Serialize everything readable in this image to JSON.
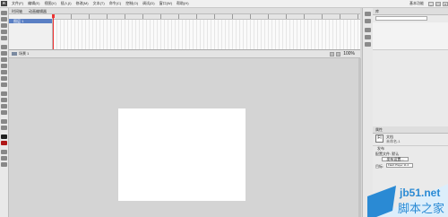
{
  "app": {
    "logo": "Fl"
  },
  "menu": [
    "文件(F)",
    "编辑(E)",
    "视图(V)",
    "插入(I)",
    "修改(M)",
    "文本(T)",
    "命令(C)",
    "控制(O)",
    "调试(D)",
    "窗口(W)",
    "帮助(H)"
  ],
  "workspace": {
    "label": "基本功能"
  },
  "timeline": {
    "tabs": [
      "时间轴",
      "动画编辑器"
    ],
    "layer_name": "图层 1"
  },
  "stage": {
    "scene": "场景 1",
    "zoom": "100%"
  },
  "library": {
    "tab": "库",
    "search_placeholder": ""
  },
  "properties": {
    "tab": "属性",
    "doc_icon": "Fl",
    "doc_label": "文档",
    "doc_name": "未命名-1",
    "publish_section": "发布",
    "config_label": "配置文件: 默认",
    "profile_button": "发布设置...",
    "target_label": "目标:",
    "player": "Flash Player 11.2"
  },
  "watermark": {
    "site": "jb51.net",
    "caption": "脚本之家",
    "colors": {
      "primary": "#2a8ad4",
      "light": "#dceefb"
    }
  }
}
